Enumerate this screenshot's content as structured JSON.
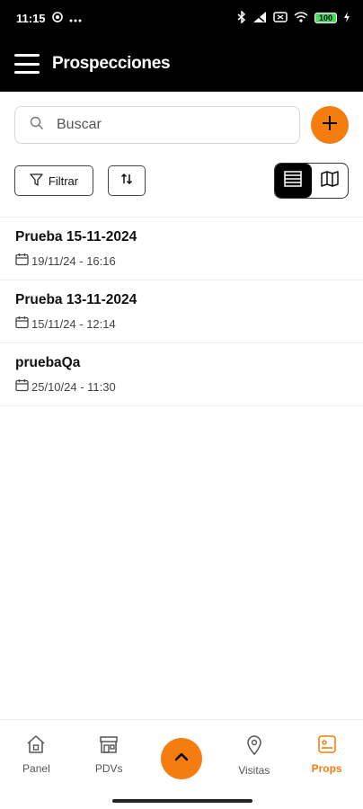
{
  "status_bar": {
    "time": "11:15",
    "battery": "100",
    "icons": [
      "whatsapp-icon",
      "more-icon",
      "bluetooth-icon",
      "signal-icon",
      "wifi-icon",
      "battery-icon",
      "charging-icon"
    ]
  },
  "header": {
    "title": "Prospecciones",
    "menu_icon": "hamburger-icon"
  },
  "search": {
    "placeholder": "Buscar",
    "value": ""
  },
  "toolbar": {
    "filter_label": "Filtrar",
    "sort_icon": "sort-icon",
    "view_options": [
      "list-view-icon",
      "map-view-icon"
    ],
    "active_view": "list"
  },
  "list": {
    "items": [
      {
        "title": "Prueba 15-11-2024",
        "date": "19/11/24 - 16:16"
      },
      {
        "title": "Prueba 13-11-2024",
        "date": "15/11/24 - 12:14"
      },
      {
        "title": "pruebaQa",
        "date": "25/10/24 - 11:30"
      }
    ]
  },
  "bottom_nav": {
    "items": [
      {
        "label": "Panel",
        "icon": "home-icon"
      },
      {
        "label": "PDVs",
        "icon": "store-icon"
      },
      {
        "label": "Visitas",
        "icon": "location-pin-icon"
      },
      {
        "label": "Props",
        "icon": "props-card-icon"
      }
    ],
    "active": "Props",
    "center_icon": "chevron-up-icon"
  },
  "colors": {
    "accent": "#f57c0e",
    "header_bg": "#000000",
    "battery": "#4cd964"
  }
}
